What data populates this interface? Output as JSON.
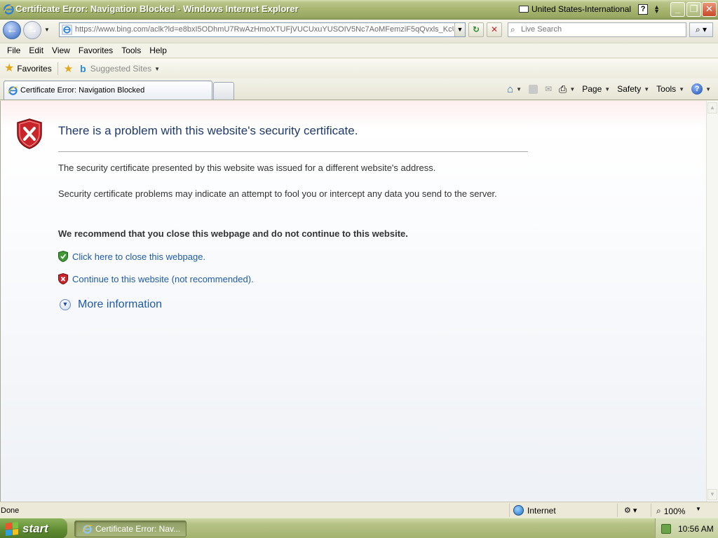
{
  "window": {
    "title": "Certificate Error: Navigation Blocked - Windows Internet Explorer",
    "language": "United States-International",
    "help_glyph": "?",
    "minimize": "_",
    "restore": "❐",
    "close": "✕"
  },
  "addressbar": {
    "back": "←",
    "forward": "→",
    "url": "https://www.bing.com/aclk?ld=e8bxI5ODhmU7RwAzHmoXTUFjVUCUxuYUSOIV5Nc7AoMFemziF5qQvxls_KcUUsc",
    "refresh": "↻",
    "stop": "✕",
    "search_placeholder": "Live Search"
  },
  "menu": [
    "File",
    "Edit",
    "View",
    "Favorites",
    "Tools",
    "Help"
  ],
  "favorites_bar": {
    "favorites_label": "Favorites",
    "suggested_sites": "Suggested Sites"
  },
  "tab": {
    "label": "Certificate Error: Navigation Blocked"
  },
  "command_bar": {
    "page": "Page",
    "safety": "Safety",
    "tools": "Tools"
  },
  "page": {
    "heading": "There is a problem with this website's security certificate.",
    "para1": "The security certificate presented by this website was issued for a different website's address.",
    "para2": "Security certificate problems may indicate an attempt to fool you or intercept any data you send to the server.",
    "recommend": "We recommend that you close this webpage and do not continue to this website.",
    "close_link": "Click here to close this webpage.",
    "continue_link": "Continue to this website (not recommended).",
    "more_info": "More information"
  },
  "statusbar": {
    "status": "Done",
    "zone": "Internet",
    "zoom": "100%"
  },
  "taskbar": {
    "start": "start",
    "task": "Certificate Error: Nav...",
    "clock": "10:56 AM"
  },
  "colors": {
    "title_olive": "#a7b56f",
    "link_blue": "#1f5aa8",
    "heading_blue": "#1f3a6b",
    "error_red": "#c8242a",
    "safe_green": "#3f9a35"
  }
}
